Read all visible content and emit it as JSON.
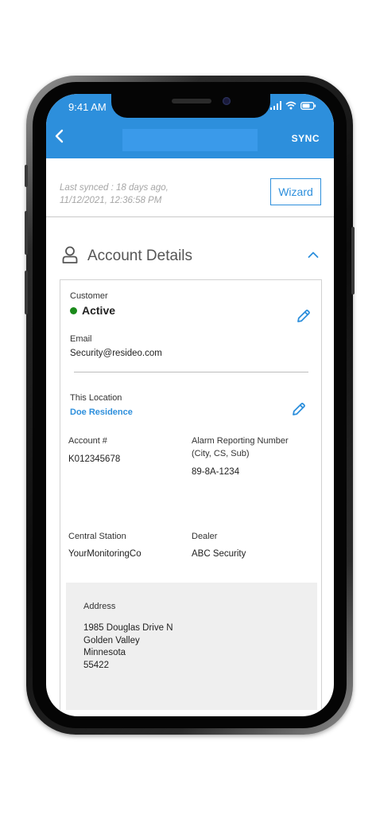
{
  "status_bar": {
    "time": "9:41 AM"
  },
  "header": {
    "sync_label": "SYNC"
  },
  "sync_bar": {
    "last_synced": "Last synced : 18 days ago,",
    "timestamp": "11/12/2021, 12:36:58 PM",
    "wizard_label": "Wizard"
  },
  "section": {
    "title": "Account Details"
  },
  "customer": {
    "label": "Customer",
    "status": "Active",
    "status_color": "#1a8a1a"
  },
  "email": {
    "label": "Email",
    "value": "Security@resideo.com"
  },
  "location": {
    "label": "This Location",
    "value": "Doe Residence"
  },
  "account": {
    "label": "Account #",
    "value": "K012345678"
  },
  "alarm": {
    "label_line1": "Alarm Reporting Number",
    "label_line2": "(City, CS, Sub)",
    "value": "89-8A-1234"
  },
  "central_station": {
    "label": "Central Station",
    "value": "YourMonitoringCo"
  },
  "dealer": {
    "label": "Dealer",
    "value": "ABC Security"
  },
  "address": {
    "label": "Address",
    "lines": [
      "1985 Douglas Drive N",
      "Golden Valley",
      "Minnesota",
      "55422"
    ]
  },
  "colors": {
    "accent": "#2d8fdc",
    "header_bg": "#2d8fdc"
  }
}
